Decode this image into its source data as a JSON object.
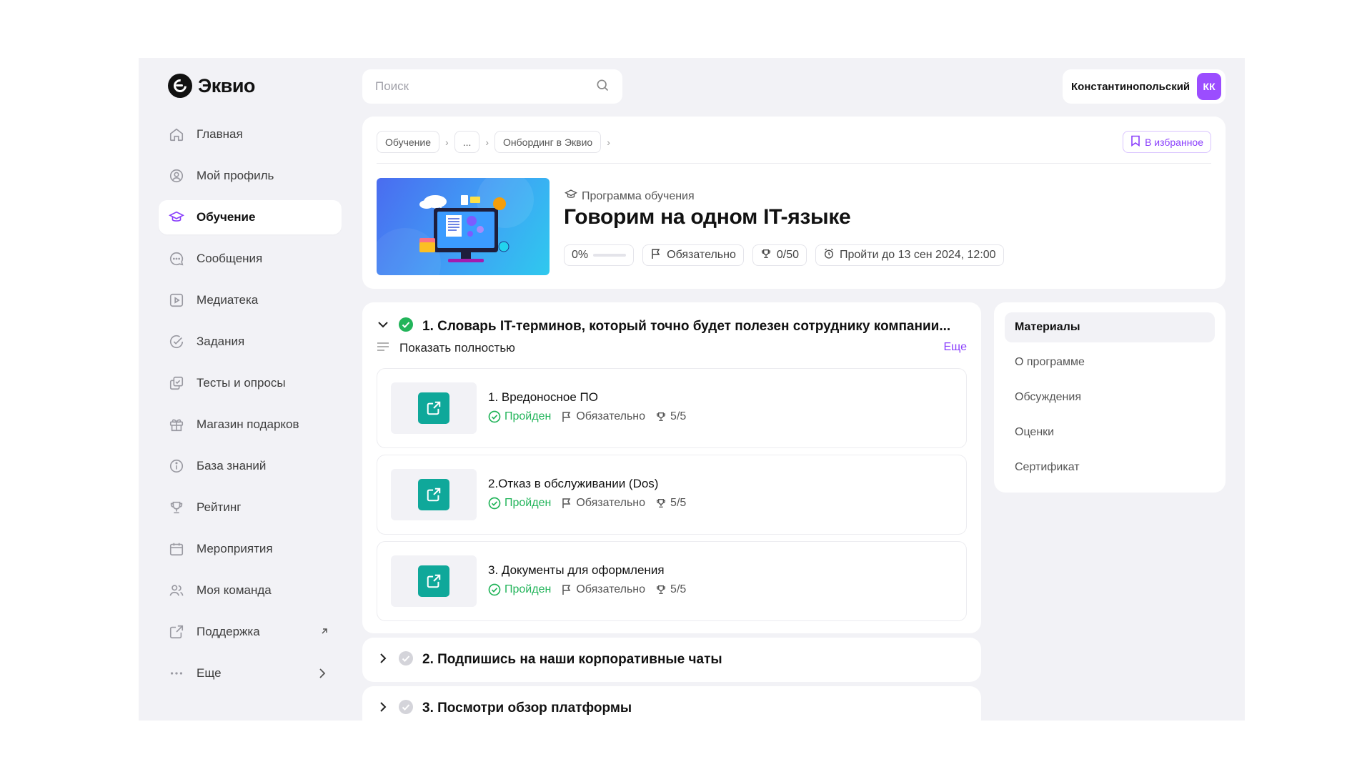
{
  "brand": {
    "name": "Эквио"
  },
  "search": {
    "placeholder": "Поиск"
  },
  "user": {
    "name": "Константинопольский",
    "initials": "КК",
    "avatar_color": "#9b4dff"
  },
  "sidebar": {
    "items": [
      {
        "label": "Главная",
        "icon": "home-icon"
      },
      {
        "label": "Мой профиль",
        "icon": "profile-icon"
      },
      {
        "label": "Обучение",
        "icon": "graduation-cap-icon",
        "active": true
      },
      {
        "label": "Сообщения",
        "icon": "chat-icon"
      },
      {
        "label": "Медиатека",
        "icon": "play-icon"
      },
      {
        "label": "Задания",
        "icon": "check-circle-icon"
      },
      {
        "label": "Тесты и опросы",
        "icon": "quiz-icon"
      },
      {
        "label": "Магазин подарков",
        "icon": "gift-icon"
      },
      {
        "label": "База знаний",
        "icon": "info-icon"
      },
      {
        "label": "Рейтинг",
        "icon": "trophy-icon"
      },
      {
        "label": "Мероприятия",
        "icon": "calendar-icon"
      },
      {
        "label": "Моя команда",
        "icon": "team-icon"
      },
      {
        "label": "Поддержка",
        "icon": "external-link-icon"
      },
      {
        "label": "Еще",
        "icon": "dots-icon"
      }
    ]
  },
  "breadcrumbs": [
    "Обучение",
    "...",
    "Онбординг в Эквио"
  ],
  "favorite_label": "В избранное",
  "program": {
    "type": "Программа обучения",
    "title": "Говорим на одном IT-языке",
    "progress_label": "0%",
    "progress": 0,
    "required": "Обязательно",
    "score": "0/50",
    "deadline": "Пройти до 13 сен 2024, 12:00"
  },
  "sections": [
    {
      "title": "1. Словарь IT-терминов, который точно будет полезен сотруднику компании...",
      "show_all": "Показать полностью",
      "more": "Еще",
      "items": [
        {
          "title": "1. Вредоносное ПО",
          "status": "Пройден",
          "required": "Обязательно",
          "score": "5/5"
        },
        {
          "title": "2.Отказ в обслуживании (Dos)",
          "status": "Пройден",
          "required": "Обязательно",
          "score": "5/5"
        },
        {
          "title": "3. Документы для оформления",
          "status": "Пройден",
          "required": "Обязательно",
          "score": "5/5"
        }
      ]
    },
    {
      "title": "2. Подпишись на наши корпоративные чаты"
    },
    {
      "title": "3. Посмотри обзор платформы"
    }
  ],
  "tabs": [
    "Материалы",
    "О программе",
    "Обсуждения",
    "Оценки",
    "Сертификат"
  ],
  "colors": {
    "accent": "#8a3ffc",
    "success": "#22b45a",
    "teal": "#0fa89a",
    "bg": "#f2f2f6"
  }
}
